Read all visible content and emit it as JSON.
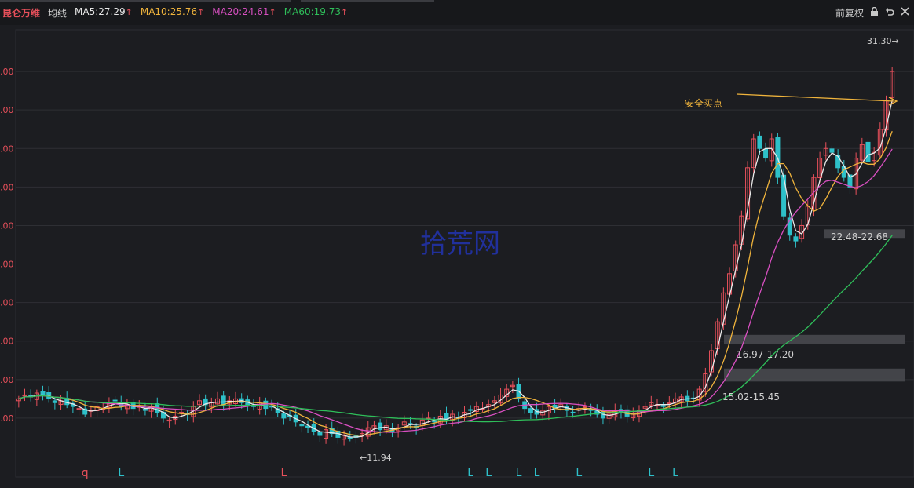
{
  "header": {
    "stock_name": "昆仑万维",
    "ma_label": "均线",
    "ma_items": [
      {
        "label": "MA5:27.29",
        "color": "#e8e8e8"
      },
      {
        "label": "MA10:25.76",
        "color": "#f0b43c"
      },
      {
        "label": "MA20:24.61",
        "color": "#d84fc1"
      },
      {
        "label": "MA60:19.73",
        "color": "#2fbf5a"
      }
    ],
    "up_arrow": "↑",
    "restore_label": "前复权",
    "lock_icon": "lock-icon",
    "back_icon": "undo-icon",
    "close_icon": "close-icon"
  },
  "chart_data": {
    "type": "candlestick",
    "ylim": [
      11,
      33
    ],
    "y_tick_labels": [
      ".00",
      ".00",
      ".00",
      ".00",
      ".00",
      ".00",
      ".00",
      ".00",
      ".00",
      ".00"
    ],
    "y_ticks": [
      31,
      29,
      27,
      25,
      23,
      21,
      19,
      17,
      15,
      13
    ],
    "colors": {
      "up": "#e8505b",
      "down": "#2ec0c9",
      "ma5": "#e8e8e8",
      "ma10": "#f0b43c",
      "ma20": "#d84fc1",
      "ma60": "#2fbf5a",
      "band": "#4a4b50"
    },
    "watermark": "拾荒网",
    "annotations": {
      "high": "31.30→",
      "low": "←11.94",
      "buy_point": "安全买点",
      "zones": [
        {
          "label": "22.48-22.68",
          "low": 22.48,
          "high": 22.68
        },
        {
          "label": "16.97-17.20",
          "low": 16.97,
          "high": 17.2
        },
        {
          "label": "15.02-15.45",
          "low": 15.02,
          "high": 15.45
        }
      ]
    },
    "bottom_markers": [
      {
        "text": "q",
        "color": "#e8505b",
        "index": 11
      },
      {
        "text": "L",
        "color": "#2ec0c9",
        "index": 17
      },
      {
        "text": "L",
        "color": "#e8505b",
        "index": 44
      },
      {
        "text": "L",
        "color": "#2ec0c9",
        "index": 75
      },
      {
        "text": "L",
        "color": "#2ec0c9",
        "index": 78
      },
      {
        "text": "L",
        "color": "#2ec0c9",
        "index": 83
      },
      {
        "text": "L",
        "color": "#2ec0c9",
        "index": 86
      },
      {
        "text": "L",
        "color": "#2ec0c9",
        "index": 93
      },
      {
        "text": "L",
        "color": "#2ec0c9",
        "index": 105
      },
      {
        "text": "L",
        "color": "#2ec0c9",
        "index": 109
      }
    ],
    "closes": [
      14.0,
      14.2,
      14.1,
      14.3,
      14.2,
      14.0,
      13.8,
      13.9,
      13.7,
      13.6,
      13.5,
      13.2,
      13.4,
      13.6,
      13.5,
      13.8,
      13.9,
      13.6,
      13.7,
      13.5,
      13.6,
      13.4,
      13.6,
      13.3,
      13.0,
      12.9,
      13.1,
      13.3,
      13.2,
      13.6,
      13.9,
      13.7,
      13.8,
      14.0,
      13.7,
      13.9,
      14.0,
      13.8,
      13.7,
      13.6,
      13.8,
      13.5,
      13.6,
      13.3,
      13.0,
      13.1,
      12.8,
      12.6,
      12.5,
      12.3,
      12.1,
      12.4,
      12.2,
      12.0,
      12.1,
      11.95,
      12.0,
      12.2,
      12.5,
      12.6,
      12.4,
      12.6,
      12.3,
      12.5,
      12.8,
      12.7,
      12.5,
      12.9,
      13.0,
      12.8,
      13.1,
      12.9,
      13.2,
      13.0,
      13.3,
      13.4,
      13.6,
      13.5,
      13.7,
      13.9,
      14.2,
      14.5,
      14.7,
      14.0,
      13.5,
      13.3,
      13.2,
      13.4,
      13.6,
      13.5,
      13.7,
      13.4,
      13.3,
      13.5,
      13.6,
      13.4,
      13.2,
      13.0,
      13.2,
      13.4,
      13.3,
      13.1,
      13.2,
      13.4,
      13.6,
      13.8,
      13.7,
      13.6,
      13.8,
      14.0,
      14.1,
      13.9,
      14.0,
      14.5,
      15.3,
      16.5,
      18.0,
      19.5,
      20.5,
      22.0,
      23.5,
      26.0,
      27.5,
      27.0,
      26.5,
      27.5,
      25.5,
      23.5,
      22.5,
      22.2,
      23.0,
      24.0,
      25.5,
      26.5,
      27.0,
      26.8,
      26.0,
      25.5,
      25.0,
      26.5,
      27.2,
      26.3,
      26.8,
      28.0,
      29.5,
      31.0
    ]
  }
}
